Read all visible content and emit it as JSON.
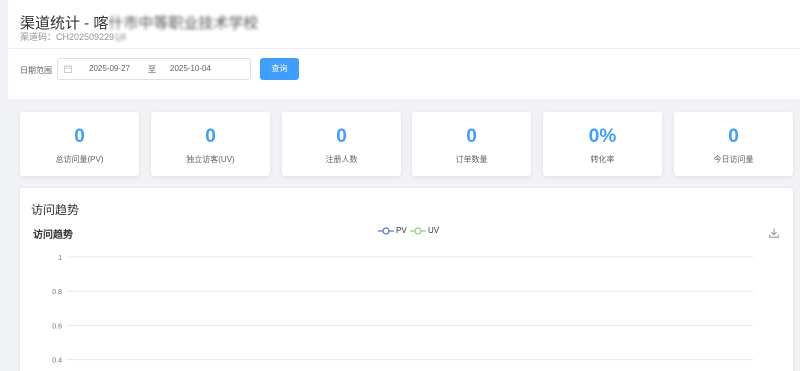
{
  "header": {
    "title_prefix": "渠道统计 - 喀",
    "title_blurred": "什市中等职业技术学校",
    "channel_code_prefix": "渠道码：CH202509229",
    "channel_code_blurred": "1j8"
  },
  "filter": {
    "label": "日期范围",
    "start_date": "2025-09-27",
    "separator": "至",
    "end_date": "2025-10-04",
    "query_label": "查询"
  },
  "stats": [
    {
      "value": "0",
      "label": "总访问量(PV)"
    },
    {
      "value": "0",
      "label": "独立访客(UV)"
    },
    {
      "value": "0",
      "label": "注册人数"
    },
    {
      "value": "0",
      "label": "订单数量"
    },
    {
      "value": "0%",
      "label": "转化率"
    },
    {
      "value": "0",
      "label": "今日访问量"
    }
  ],
  "trend": {
    "heading": "访问趋势"
  },
  "chart_data": {
    "type": "line",
    "title": "访问趋势",
    "series": [
      {
        "name": "PV",
        "color": "#5470c6",
        "values": []
      },
      {
        "name": "UV",
        "color": "#91cc75",
        "values": []
      }
    ],
    "y_ticks": [
      "1",
      "0.8",
      "0.6",
      "0.4"
    ],
    "ylim": [
      0,
      1
    ],
    "grid": true,
    "legend_position": "top-center"
  },
  "colors": {
    "primary": "#409eff",
    "pv_series": "#5470c6",
    "uv_series": "#91cc75"
  },
  "icons": {
    "calendar": "calendar-icon",
    "download": "download-icon"
  }
}
